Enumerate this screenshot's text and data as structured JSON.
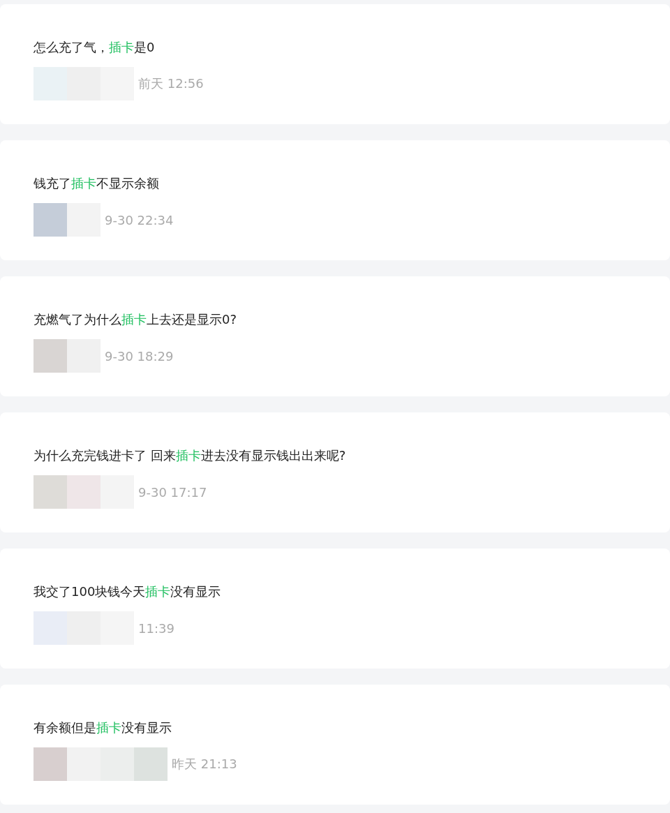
{
  "posts": [
    {
      "question": {
        "before": "怎么充了气，",
        "highlight": "插卡",
        "after": "是0"
      },
      "time": "前天 12:56"
    },
    {
      "question": {
        "before": "钱充了",
        "highlight": "插卡",
        "after": "不显示余额"
      },
      "time": "9-30 22:34"
    },
    {
      "question": {
        "before": "充燃气了为什么",
        "highlight": "插卡",
        "after": "上去还是显示0?"
      },
      "time": "9-30 18:29"
    },
    {
      "question": {
        "before": "为什么充完钱进卡了 回来",
        "highlight": "插卡",
        "after": "进去没有显示钱出出来呢?"
      },
      "time": "9-30 17:17"
    },
    {
      "question": {
        "before": "我交了100块钱今天",
        "highlight": "插卡",
        "after": "没有显示"
      },
      "time": "11:39"
    },
    {
      "question": {
        "before": "有余额但是",
        "highlight": "插卡",
        "after": "没有显示"
      },
      "time": "昨天 21:13"
    }
  ]
}
